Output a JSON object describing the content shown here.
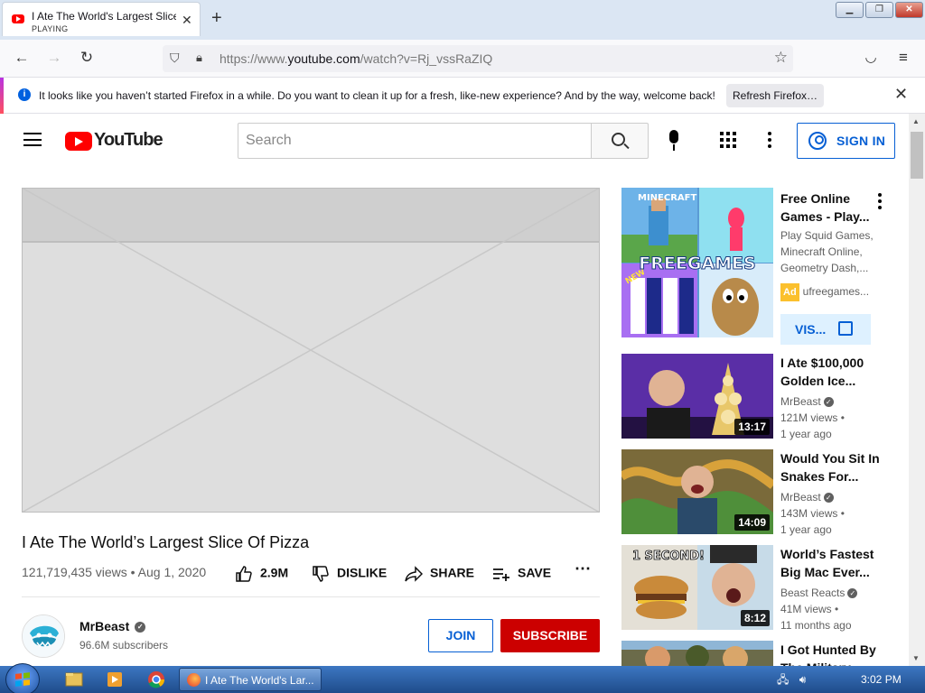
{
  "browser": {
    "tab_title": "I Ate The World's Largest Slice Of Pizza - YouTube",
    "tab_status": "PLAYING",
    "url_prefix": "https://www.",
    "url_domain": "youtube.com",
    "url_path": "/watch?v=Rj_vssRaZIQ",
    "notification": "It looks like you haven’t started Firefox in a while. Do you want to clean it up for a fresh, like-new experience? And by the way, welcome back!",
    "refresh_label": "Refresh Firefox…"
  },
  "youtube": {
    "logo_text": "YouTube",
    "search_placeholder": "Search",
    "sign_in": "SIGN IN"
  },
  "video": {
    "title": "I Ate The World’s Largest Slice Of Pizza",
    "views_date": "121,719,435 views • Aug 1, 2020",
    "likes": "2.9M",
    "dislike": "DISLIKE",
    "share": "SHARE",
    "save": "SAVE",
    "channel": "MrBeast",
    "subscribers": "96.6M subscribers",
    "join": "JOIN",
    "subscribe": "SUBSCRIBE"
  },
  "sidebar": {
    "ad": {
      "title": "Free Online Games - Play...",
      "description": "Play Squid Games, Minecraft Online, Geometry Dash,...",
      "badge": "Ad",
      "domain": "ufreegames...",
      "visit": "VIS...",
      "thumb_text_top": "MINECRAFT",
      "thumb_text_mid": "FREEGAMES",
      "thumb_text_new": "NEW"
    },
    "videos": [
      {
        "title": "I Ate $100,000 Golden Ice...",
        "channel": "MrBeast",
        "views": "121M views •",
        "age": "1 year ago",
        "duration": "13:17"
      },
      {
        "title": "Would You Sit In Snakes For...",
        "channel": "MrBeast",
        "views": "143M views •",
        "age": "1 year ago",
        "duration": "14:09"
      },
      {
        "title": "World’s Fastest Big Mac Ever...",
        "channel": "Beast Reacts",
        "views": "41M views •",
        "age": "11 months ago",
        "duration": "8:12",
        "thumb_text": "1 SECOND!"
      },
      {
        "title": "I Got Hunted By The Military..."
      }
    ]
  },
  "taskbar": {
    "task_title": "I Ate The World's Lar...",
    "time": "3:02 PM"
  },
  "colors": {
    "youtube_red": "#ff0000",
    "subscribe_red": "#cc0000",
    "link_blue": "#065fd4"
  }
}
